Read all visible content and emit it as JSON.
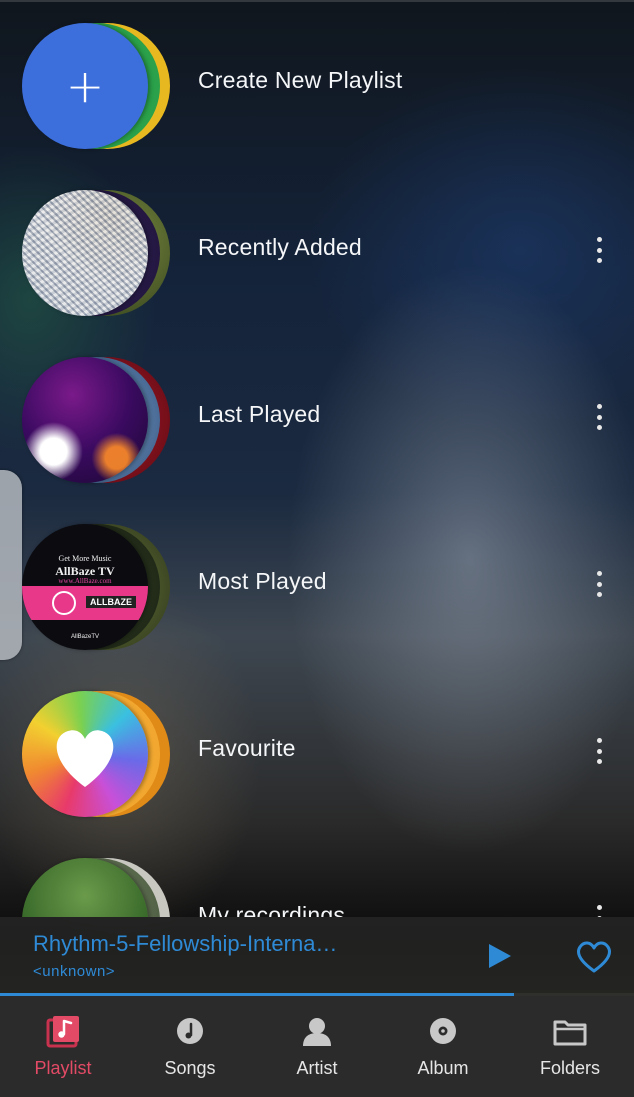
{
  "playlists": [
    {
      "label": "Create New Playlist",
      "has_menu": false
    },
    {
      "label": "Recently Added",
      "has_menu": true
    },
    {
      "label": "Last Played",
      "has_menu": true
    },
    {
      "label": "Most Played",
      "has_menu": true
    },
    {
      "label": "Favourite",
      "has_menu": true
    },
    {
      "label": "My recordings",
      "has_menu": true
    }
  ],
  "album_art": {
    "allbaze_line1": "Get More Music",
    "allbaze_line2": "AllBaze TV",
    "allbaze_line3": "www.AllBaze.com",
    "allbaze_banner": "ALLBAZE",
    "allbaze_footer": "AllBazeTV"
  },
  "now_playing": {
    "title": "Rhythm-5-Fellowship-Interna…",
    "artist": "<unknown>",
    "progress_fraction": 0.81
  },
  "bottom_nav": [
    {
      "label": "Playlist",
      "icon": "playlist-icon",
      "active": true
    },
    {
      "label": "Songs",
      "icon": "song-icon",
      "active": false
    },
    {
      "label": "Artist",
      "icon": "artist-icon",
      "active": false
    },
    {
      "label": "Album",
      "icon": "album-icon",
      "active": false
    },
    {
      "label": "Folders",
      "icon": "folder-icon",
      "active": false
    }
  ],
  "colors": {
    "accent": "#2f8ad6",
    "active_tab": "#e24a66",
    "create_button": "#3c6fdc"
  }
}
